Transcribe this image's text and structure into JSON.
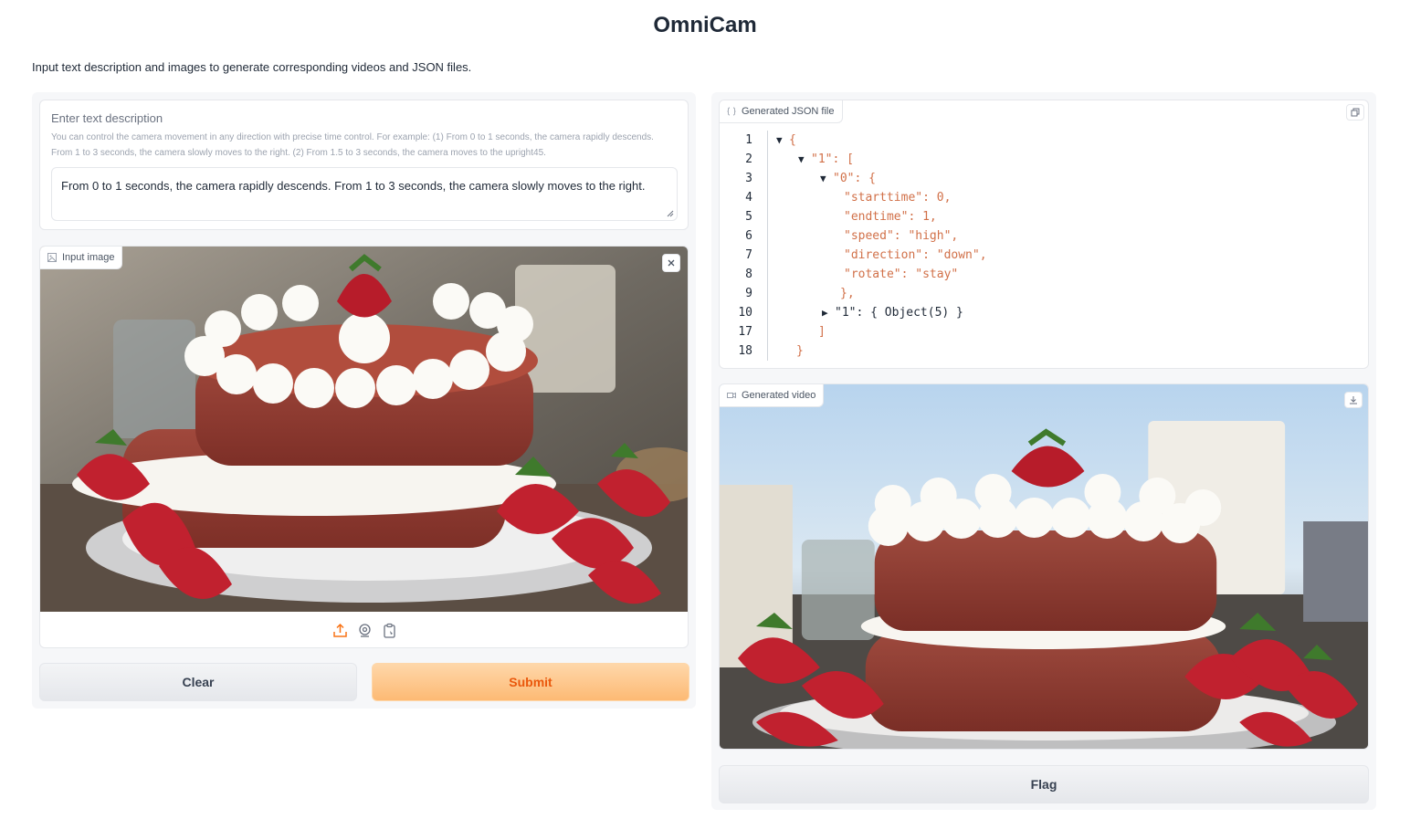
{
  "app": {
    "title": "OmniCam",
    "description": "Input text description and images to generate corresponding videos and JSON files."
  },
  "text_input": {
    "label": "Enter text description",
    "info": "You can control the camera movement in any direction with precise time control. For example: (1) From 0 to 1 seconds, the camera rapidly descends. From 1 to 3 seconds, the camera slowly moves to the right. (2) From 1.5 to 3 seconds, the camera moves to the upright45.",
    "value": "From 0 to 1 seconds, the camera rapidly descends. From 1 to 3 seconds, the camera slowly moves to the right."
  },
  "image_input": {
    "label": "Input image",
    "icons": [
      "upload-icon",
      "webcam-icon",
      "clipboard-icon"
    ]
  },
  "buttons": {
    "clear": "Clear",
    "submit": "Submit",
    "flag": "Flag"
  },
  "json_output": {
    "label": "Generated JSON file",
    "lines": [
      {
        "n": "1",
        "text": "{"
      },
      {
        "n": "2",
        "text": "\"1\": ["
      },
      {
        "n": "3",
        "text": "\"0\": {"
      },
      {
        "n": "4",
        "text": "\"starttime\": 0,"
      },
      {
        "n": "5",
        "text": "\"endtime\": 1,"
      },
      {
        "n": "6",
        "text": "\"speed\": \"high\","
      },
      {
        "n": "7",
        "text": "\"direction\": \"down\","
      },
      {
        "n": "8",
        "text": "\"rotate\": \"stay\""
      },
      {
        "n": "9",
        "text": "},"
      },
      {
        "n": "10",
        "text": "\"1\": { Object(5) }"
      },
      {
        "n": "17",
        "text": "]"
      },
      {
        "n": "18",
        "text": "}"
      }
    ]
  },
  "video_output": {
    "label": "Generated video"
  },
  "colors": {
    "accent": "#ea580c",
    "submit_bg": "#fdba74",
    "panel_bg": "#f6f7f9"
  }
}
